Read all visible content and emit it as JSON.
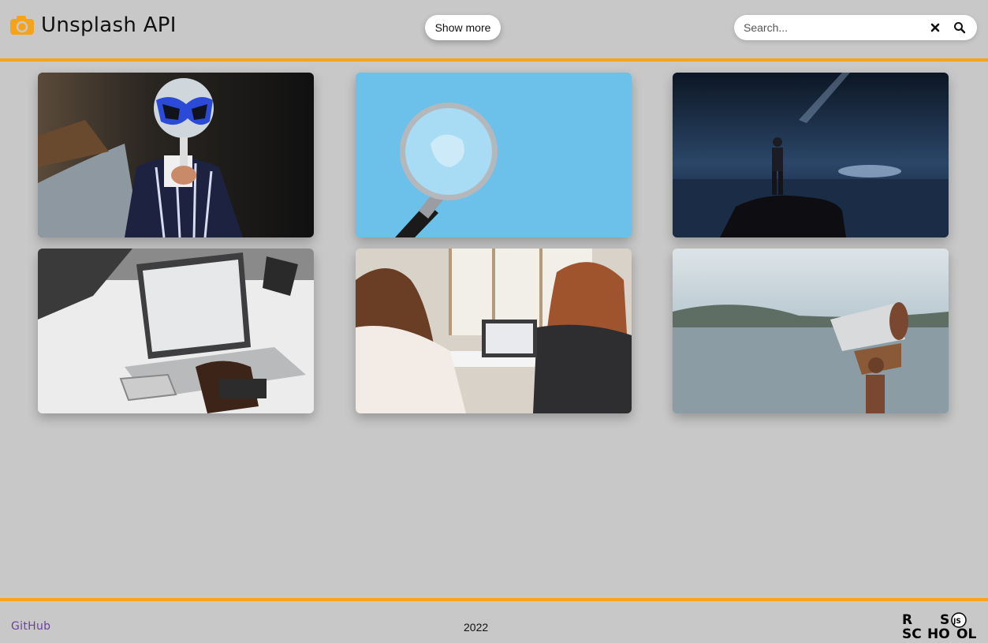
{
  "header": {
    "app_title": "Unsplash API",
    "show_more_label": "Show more",
    "search": {
      "placeholder": "Search...",
      "value": ""
    }
  },
  "colors": {
    "accent": "#f5a31a",
    "background": "#c8c8c8",
    "link": "#6b3fa0"
  },
  "gallery": [
    {
      "subject": "man-with-magnifying-glass"
    },
    {
      "subject": "magnifying-glass-on-blue"
    },
    {
      "subject": "man-on-rock-at-night"
    },
    {
      "subject": "laptop-google-search"
    },
    {
      "subject": "two-women-at-laptop"
    },
    {
      "subject": "coin-telescope-by-lake"
    }
  ],
  "footer": {
    "github_label": "GitHub",
    "year": "2022",
    "school_logo_text": "RS SCHOOL"
  }
}
